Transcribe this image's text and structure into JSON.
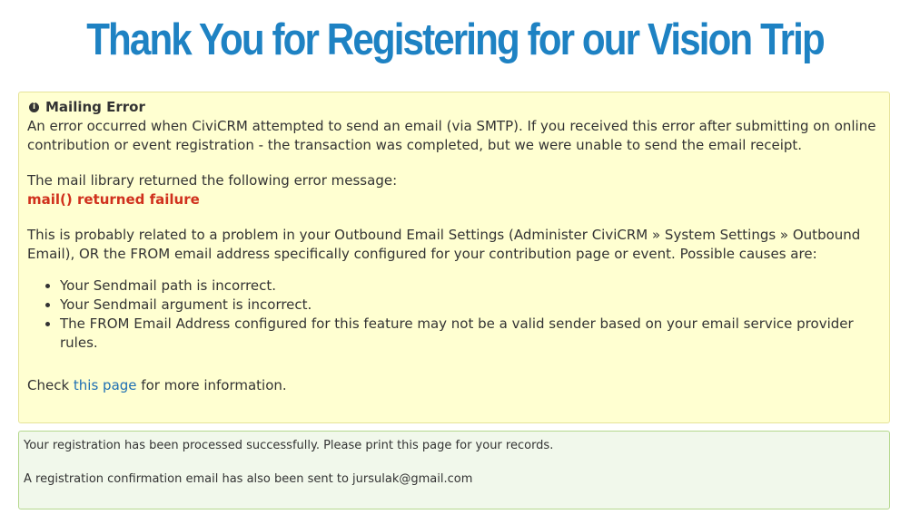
{
  "page": {
    "title": "Thank You for Registering for our Vision Trip"
  },
  "error_box": {
    "icon": "info-icon",
    "icon_glyph": "i",
    "heading": "Mailing Error",
    "intro": "An error occurred when CiviCRM attempted to send an email (via SMTP). If you received this error after submitting on online contribution or event registration - the transaction was completed, but we were unable to send the email receipt.",
    "library_label": "The mail library returned the following error message:",
    "error_message": "mail() returned failure",
    "probable_cause": "This is probably related to a problem in your Outbound Email Settings (Administer CiviCRM » System Settings » Outbound Email), OR the FROM email address specifically configured for your contribution page or event. Possible causes are:",
    "causes": [
      "Your Sendmail path is incorrect.",
      "Your Sendmail argument is incorrect.",
      "The FROM Email Address configured for this feature may not be a valid sender based on your email service provider rules."
    ],
    "check_prefix": "Check ",
    "check_link": "this page",
    "check_suffix": " for more information."
  },
  "success_box": {
    "line1": "Your registration has been processed successfully. Please print this page for your records.",
    "line2": "A registration confirmation email has also been sent to jursulak@gmail.com"
  },
  "colors": {
    "title": "#1e82c3",
    "error_bg": "#ffffd1",
    "error_text": "#d0311d",
    "link": "#1e6fb3",
    "success_bg": "#f1f8eb"
  }
}
